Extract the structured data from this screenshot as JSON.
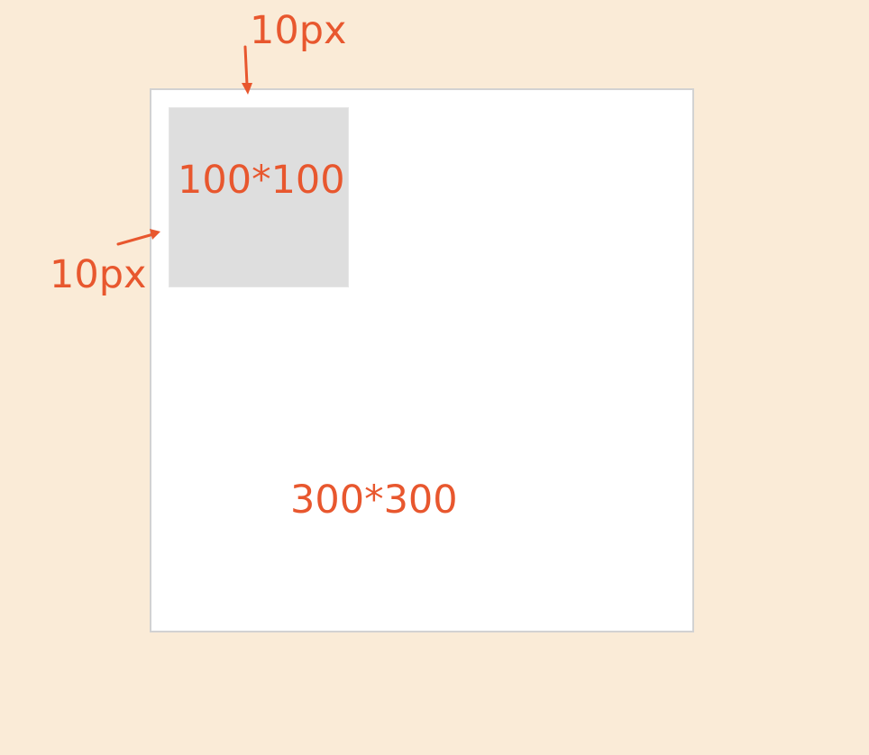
{
  "labels": {
    "top_gap": "10px",
    "left_gap": "10px",
    "inner_size": "100*100",
    "outer_size": "300*300"
  },
  "colors": {
    "background": "#faebd7",
    "outer_fill": "#ffffff",
    "outer_border": "#d2d2d2",
    "inner_fill": "#dedede",
    "annotation": "#e8572e"
  }
}
